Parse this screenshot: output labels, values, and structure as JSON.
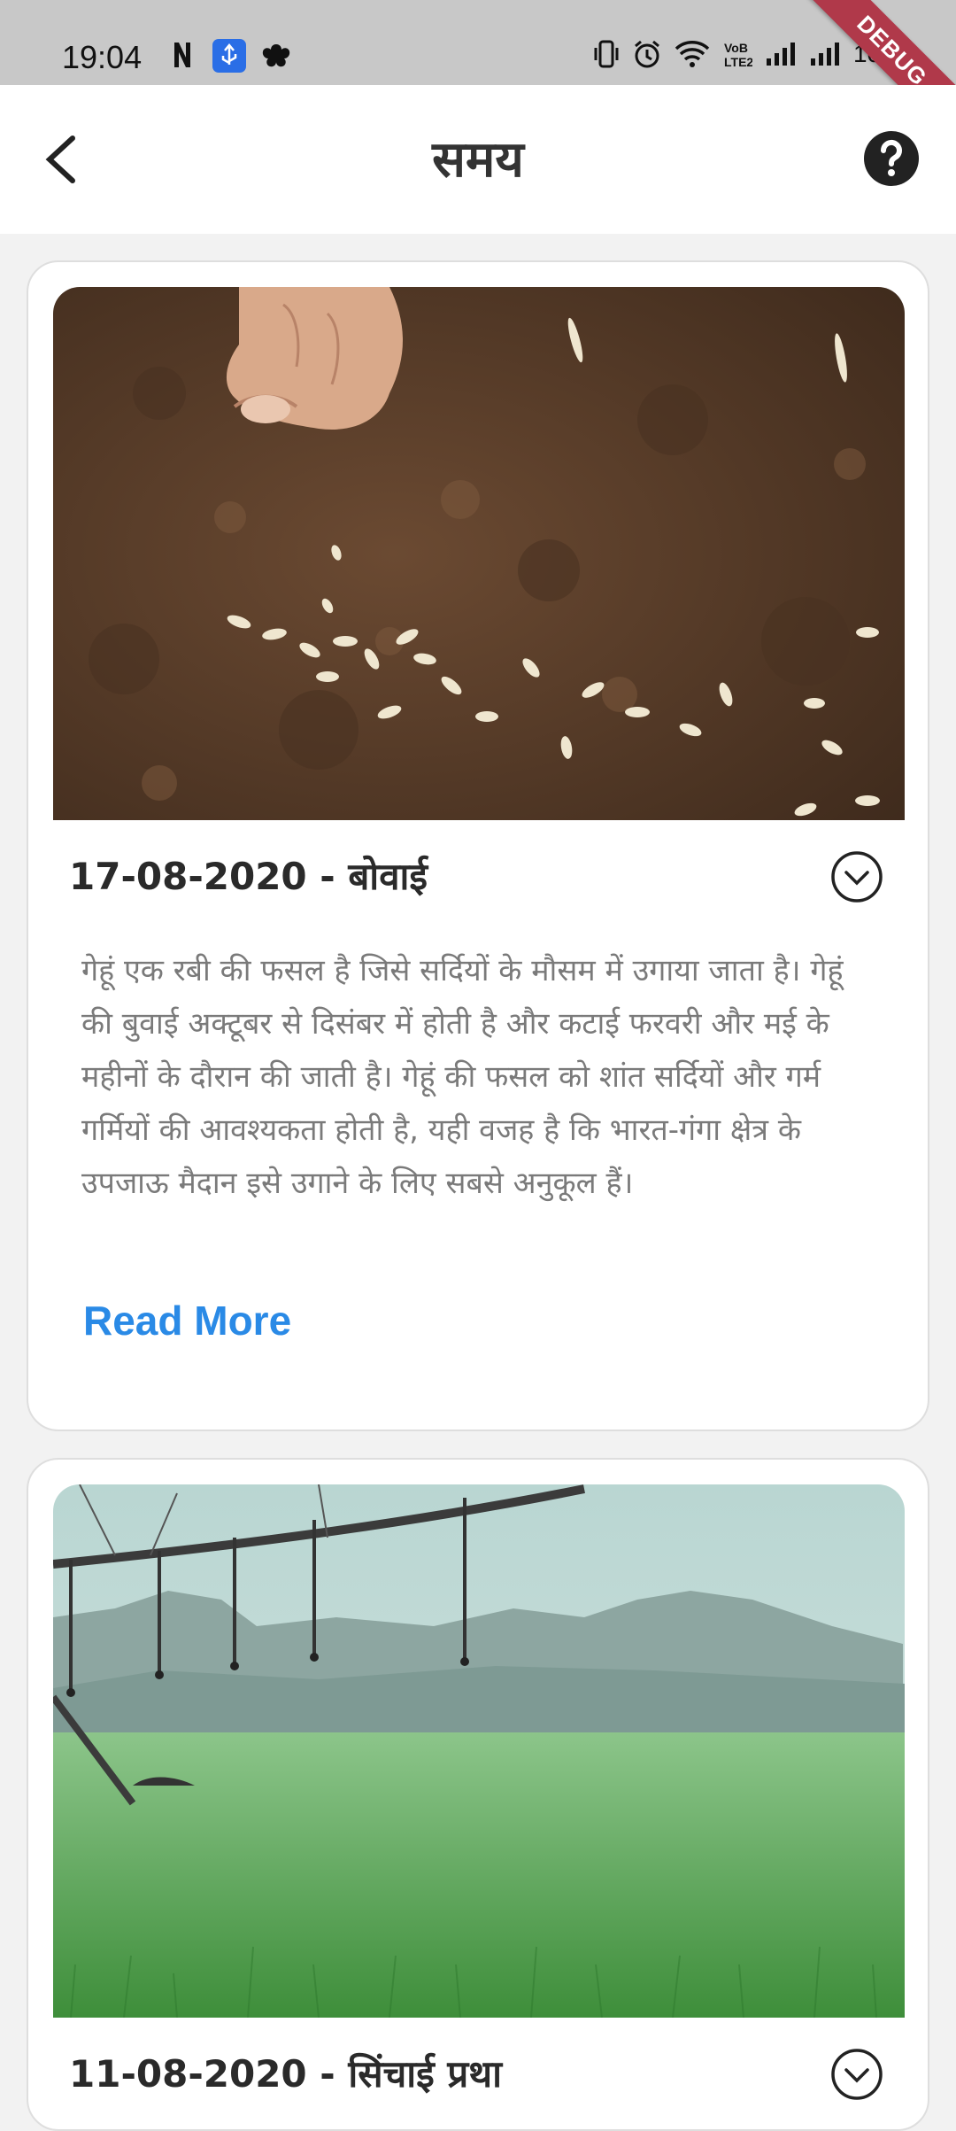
{
  "status_bar": {
    "time": "19:04",
    "battery": "10%",
    "icons": [
      "n-icon",
      "usb-icon",
      "app-icon",
      "vibrate-icon",
      "alarm-icon",
      "wifi-icon",
      "volte-icon",
      "signal-icon",
      "signal-icon"
    ],
    "debug_label": "DEBUG"
  },
  "appbar": {
    "title": "समय",
    "back_icon": "chevron-left-icon",
    "help_icon": "help-circle-icon"
  },
  "cards": [
    {
      "title": "17-08-2020 - बोवाई",
      "description": " गेहूं एक रबी की फसल है जिसे सर्दियों के मौसम में उगाया जाता है। गेहूं की बुवाई अक्टूबर से दिसंबर में होती है और कटाई फरवरी और मई के महीनों के दौरान की जाती है। गेहूं की फसल को शांत सर्दियों और गर्म गर्मियों की आवश्यकता होती है, यही वजह है कि भारत-गंगा क्षेत्र के उपजाऊ मैदान इसे उगाने के लिए सबसे अनुकूल हैं।",
      "read_more": "Read More",
      "image": "hand-sowing-seeds-photo"
    },
    {
      "title": "11-08-2020 - सिंचाई प्रथा",
      "image": "irrigation-wheat-field-photo"
    }
  ],
  "colors": {
    "accent": "#2a8ae6",
    "statusbar": "#c8c8c8",
    "debug": "#b0394a"
  }
}
